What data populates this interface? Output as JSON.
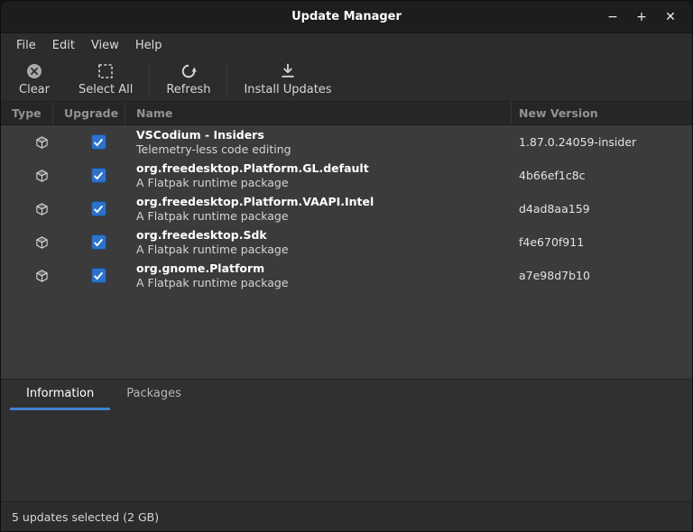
{
  "window": {
    "title": "Update Manager",
    "controls": {
      "minimize": "−",
      "maximize": "+",
      "close": "✕"
    }
  },
  "menu": {
    "items": [
      "File",
      "Edit",
      "View",
      "Help"
    ]
  },
  "toolbar": {
    "buttons": [
      {
        "label": "Clear",
        "icon": "clear-icon"
      },
      {
        "label": "Select All",
        "icon": "select-all-icon"
      },
      {
        "label": "Refresh",
        "icon": "refresh-icon"
      },
      {
        "label": "Install Updates",
        "icon": "install-updates-icon"
      }
    ]
  },
  "table": {
    "columns": [
      "Type",
      "Upgrade",
      "Name",
      "New Version"
    ],
    "row_icon": "package-icon",
    "rows": [
      {
        "name": "VSCodium - Insiders",
        "description": "Telemetry-less code editing",
        "new_version": "1.87.0.24059-insider",
        "checked": true
      },
      {
        "name": "org.freedesktop.Platform.GL.default",
        "description": "A Flatpak runtime package",
        "new_version": "4b66ef1c8c",
        "checked": true
      },
      {
        "name": "org.freedesktop.Platform.VAAPI.Intel",
        "description": "A Flatpak runtime package",
        "new_version": "d4ad8aa159",
        "checked": true
      },
      {
        "name": "org.freedesktop.Sdk",
        "description": "A Flatpak runtime package",
        "new_version": "f4e670f911",
        "checked": true
      },
      {
        "name": "org.gnome.Platform",
        "description": "A Flatpak runtime package",
        "new_version": "a7e98d7b10",
        "checked": true
      }
    ]
  },
  "bottom_tabs": {
    "tabs": [
      {
        "label": "Information",
        "active": true
      },
      {
        "label": "Packages",
        "active": false
      }
    ]
  },
  "status_bar": {
    "text": "5 updates selected (2 GB)"
  },
  "colors": {
    "accent": "#3f84cf",
    "checkbox-blue": "#2d72c8"
  }
}
